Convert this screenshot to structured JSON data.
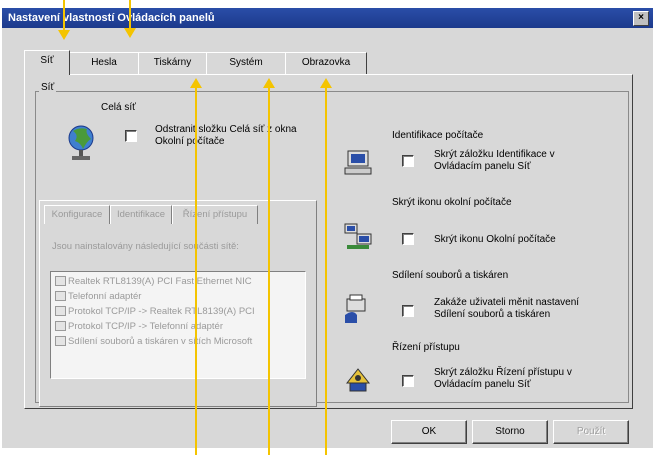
{
  "window": {
    "title": "Nastavení vlastností Ovládacích panelů",
    "close_glyph": "×"
  },
  "tabs": [
    {
      "label": "Síť",
      "active": true
    },
    {
      "label": "Hesla"
    },
    {
      "label": "Tiskárny"
    },
    {
      "label": "Systém"
    },
    {
      "label": "Obrazovka"
    }
  ],
  "group": {
    "label": "Síť"
  },
  "entire_network": {
    "heading": "Celá síť",
    "option_line1": "Odstranit složku Celá síť z okna",
    "option_line2": "Okolní počítače"
  },
  "inner_tabs": [
    "Konfigurace",
    "Identifikace",
    "Řízení přístupu"
  ],
  "components_caption": "Jsou nainstalovány následující součásti sítě:",
  "components": [
    "Realtek RTL8139(A) PCI Fast Ethernet NIC",
    "Telefonní adaptér",
    "Protokol TCP/IP -> Realtek RTL8139(A) PCI",
    "Protokol TCP/IP -> Telefonní adaptér",
    "Sdílení souborů a tiskáren v sítích Microsoft"
  ],
  "right_options": [
    {
      "heading": "Identifikace počítače",
      "line1": "Skrýt záložku Identifikace v",
      "line2": "Ovládacím panelu Síť",
      "icon": "computer-id-icon"
    },
    {
      "heading": "Skrýt ikonu okolní počítače",
      "line1": "Skrýt ikonu Okolní počítače",
      "line2": "",
      "icon": "network-neighborhood-icon"
    },
    {
      "heading": "Sdílení souborů a tiskáren",
      "line1": "Zakáže uživateli měnit nastavení",
      "line2": "Sdílení souborů a tiskáren",
      "icon": "file-printer-sharing-icon"
    },
    {
      "heading": "Řízení přístupu",
      "line1": "Skrýt záložku Řízení přístupu v",
      "line2": "Ovládacím panelu Síť",
      "icon": "access-control-icon"
    }
  ],
  "buttons": {
    "ok": "OK",
    "cancel": "Storno",
    "apply": "Použít"
  },
  "colors": {
    "arrow": "#f4c400",
    "titlebar": "#1c3a8c",
    "dialog": "#d8d8d8"
  }
}
